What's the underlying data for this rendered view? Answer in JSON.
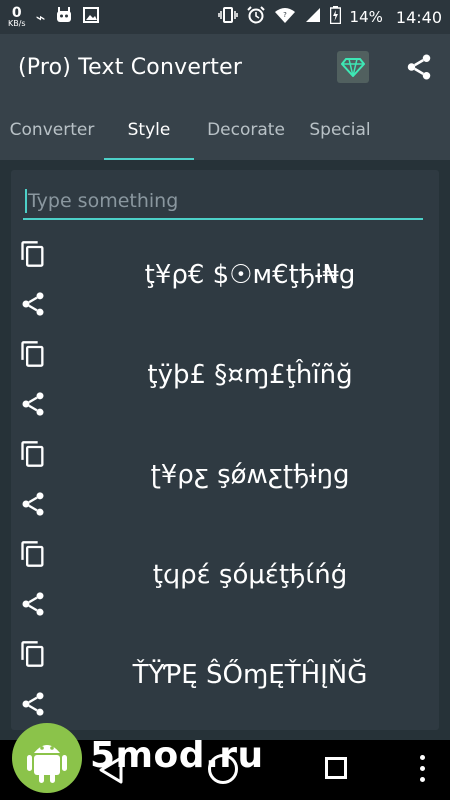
{
  "status_bar": {
    "speed_value": "0",
    "speed_unit": "KB/s",
    "battery": "14%",
    "time": "14:40"
  },
  "app_bar": {
    "title": "(Pro) Text Converter"
  },
  "tabs": [
    {
      "label": "Converter",
      "active": false
    },
    {
      "label": "Style",
      "active": true
    },
    {
      "label": "Decorate",
      "active": false
    },
    {
      "label": "Special",
      "active": false
    }
  ],
  "input": {
    "placeholder": "Type something"
  },
  "styled_results": [
    {
      "text": "ţ¥ρ€ $☉м€ţђɨ₦ց"
    },
    {
      "text": "ţÿþ£ §¤ɱ£ţĥĩñğ"
    },
    {
      "text": "ʈ¥ρƹ şǿʍƹʈђɨŋց"
    },
    {
      "text": "ţ‎ϥρέ şόμέţђίńģ"
    },
    {
      "text": "ŤŸƤĘ ŜŐɱĘŤĤĮŇĞ"
    }
  ],
  "watermark": {
    "text": "5mod.ru"
  },
  "colors": {
    "accent": "#4dd0c8",
    "app_bar": "#37424a",
    "background": "#263238",
    "card": "#2f3a42"
  }
}
